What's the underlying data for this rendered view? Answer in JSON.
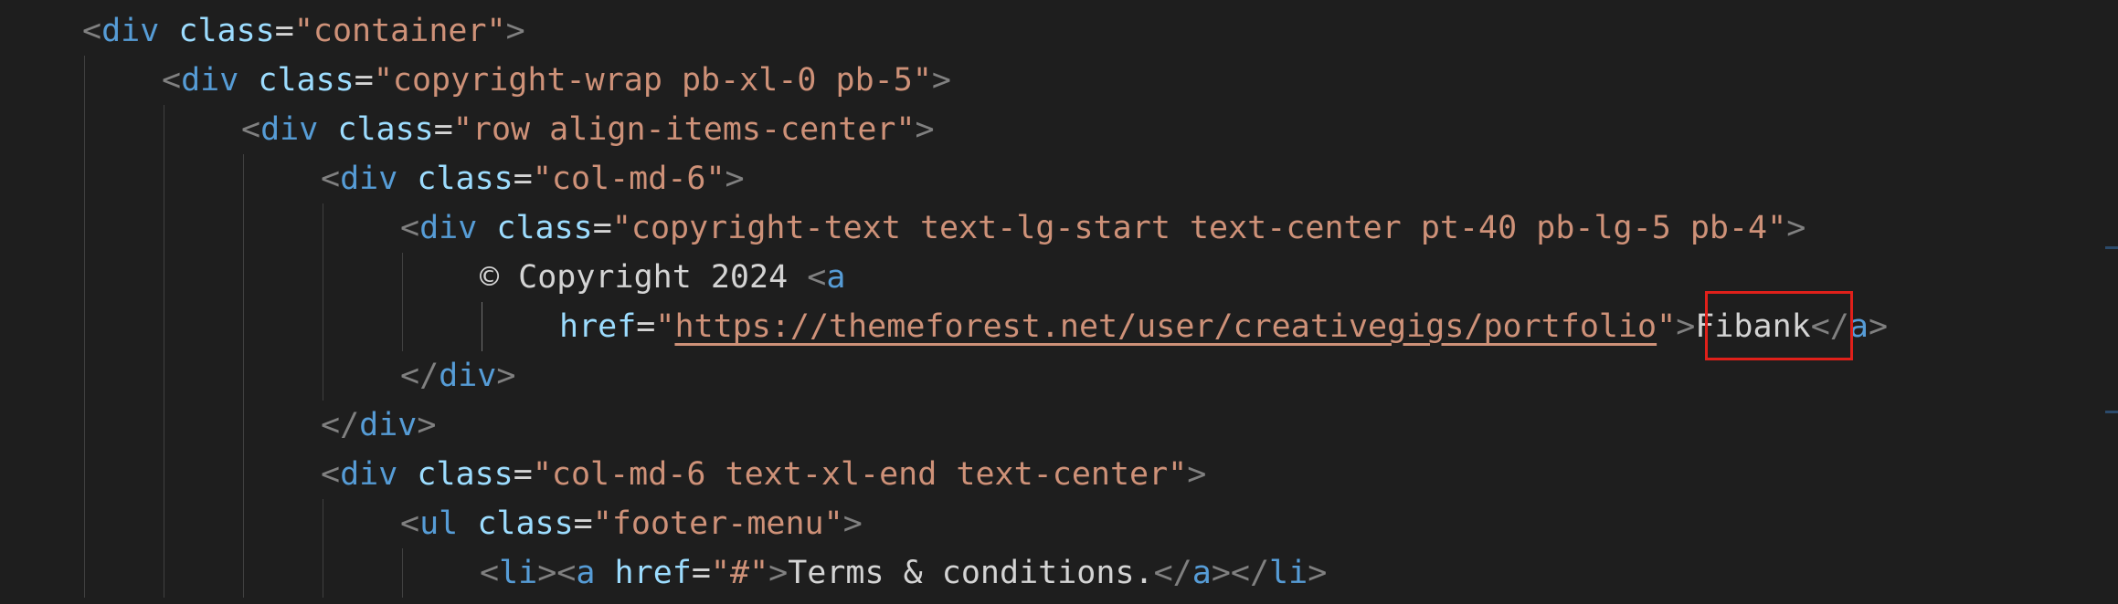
{
  "editor": {
    "lines": [
      {
        "indent": 1,
        "tokens": [
          {
            "t": "punc",
            "v": "<"
          },
          {
            "t": "tag",
            "v": "div"
          },
          {
            "t": "text",
            "v": " "
          },
          {
            "t": "attr",
            "v": "class"
          },
          {
            "t": "text",
            "v": "="
          },
          {
            "t": "str",
            "v": "\"container\""
          },
          {
            "t": "punc",
            "v": ">"
          }
        ]
      },
      {
        "indent": 2,
        "tokens": [
          {
            "t": "punc",
            "v": "<"
          },
          {
            "t": "tag",
            "v": "div"
          },
          {
            "t": "text",
            "v": " "
          },
          {
            "t": "attr",
            "v": "class"
          },
          {
            "t": "text",
            "v": "="
          },
          {
            "t": "str",
            "v": "\"copyright-wrap pb-xl-0 pb-5\""
          },
          {
            "t": "punc",
            "v": ">"
          }
        ]
      },
      {
        "indent": 3,
        "tokens": [
          {
            "t": "punc",
            "v": "<"
          },
          {
            "t": "tag",
            "v": "div"
          },
          {
            "t": "text",
            "v": " "
          },
          {
            "t": "attr",
            "v": "class"
          },
          {
            "t": "text",
            "v": "="
          },
          {
            "t": "str",
            "v": "\"row align-items-center\""
          },
          {
            "t": "punc",
            "v": ">"
          }
        ]
      },
      {
        "indent": 4,
        "tokens": [
          {
            "t": "punc",
            "v": "<"
          },
          {
            "t": "tag",
            "v": "div"
          },
          {
            "t": "text",
            "v": " "
          },
          {
            "t": "attr",
            "v": "class"
          },
          {
            "t": "text",
            "v": "="
          },
          {
            "t": "str",
            "v": "\"col-md-6\""
          },
          {
            "t": "punc",
            "v": ">"
          }
        ]
      },
      {
        "indent": 5,
        "tokens": [
          {
            "t": "punc",
            "v": "<"
          },
          {
            "t": "tag",
            "v": "div"
          },
          {
            "t": "text",
            "v": " "
          },
          {
            "t": "attr",
            "v": "class"
          },
          {
            "t": "text",
            "v": "="
          },
          {
            "t": "str",
            "v": "\"copyright-text text-lg-start text-center pt-40 pb-lg-5 pb-4\""
          },
          {
            "t": "punc",
            "v": ">"
          }
        ]
      },
      {
        "indent": 6,
        "tokens": [
          {
            "t": "text",
            "v": "© Copyright 2024 "
          },
          {
            "t": "punc",
            "v": "<"
          },
          {
            "t": "tag",
            "v": "a"
          }
        ]
      },
      {
        "indent": 7,
        "tokens": [
          {
            "t": "attr",
            "v": "href"
          },
          {
            "t": "text",
            "v": "="
          },
          {
            "t": "str",
            "v": "\""
          },
          {
            "t": "str link",
            "v": "https://themeforest.net/user/creativegigs/portfolio"
          },
          {
            "t": "str",
            "v": "\""
          },
          {
            "t": "punc",
            "v": ">"
          },
          {
            "t": "text",
            "v": "Fibank"
          },
          {
            "t": "punc",
            "v": "</"
          },
          {
            "t": "tag",
            "v": "a"
          },
          {
            "t": "punc",
            "v": ">"
          }
        ]
      },
      {
        "indent": 5,
        "tokens": [
          {
            "t": "punc",
            "v": "</"
          },
          {
            "t": "tag",
            "v": "div"
          },
          {
            "t": "punc",
            "v": ">"
          }
        ]
      },
      {
        "indent": 4,
        "tokens": [
          {
            "t": "punc",
            "v": "</"
          },
          {
            "t": "tag",
            "v": "div"
          },
          {
            "t": "punc",
            "v": ">"
          }
        ]
      },
      {
        "indent": 4,
        "tokens": [
          {
            "t": "punc",
            "v": "<"
          },
          {
            "t": "tag",
            "v": "div"
          },
          {
            "t": "text",
            "v": " "
          },
          {
            "t": "attr",
            "v": "class"
          },
          {
            "t": "text",
            "v": "="
          },
          {
            "t": "str",
            "v": "\"col-md-6 text-xl-end text-center\""
          },
          {
            "t": "punc",
            "v": ">"
          }
        ]
      },
      {
        "indent": 5,
        "tokens": [
          {
            "t": "punc",
            "v": "<"
          },
          {
            "t": "tag",
            "v": "ul"
          },
          {
            "t": "text",
            "v": " "
          },
          {
            "t": "attr",
            "v": "class"
          },
          {
            "t": "text",
            "v": "="
          },
          {
            "t": "str",
            "v": "\"footer-menu\""
          },
          {
            "t": "punc",
            "v": ">"
          }
        ]
      },
      {
        "indent": 6,
        "tokens": [
          {
            "t": "punc",
            "v": "<"
          },
          {
            "t": "tag",
            "v": "li"
          },
          {
            "t": "punc",
            "v": "><"
          },
          {
            "t": "tag",
            "v": "a"
          },
          {
            "t": "text",
            "v": " "
          },
          {
            "t": "attr",
            "v": "href"
          },
          {
            "t": "text",
            "v": "="
          },
          {
            "t": "str",
            "v": "\"#\""
          },
          {
            "t": "punc",
            "v": ">"
          },
          {
            "t": "text",
            "v": "Terms & conditions."
          },
          {
            "t": "punc",
            "v": "</"
          },
          {
            "t": "tag",
            "v": "a"
          },
          {
            "t": "punc",
            "v": "></"
          },
          {
            "t": "tag",
            "v": "li"
          },
          {
            "t": "punc",
            "v": ">"
          }
        ]
      }
    ],
    "highlighted_text": "Fibank",
    "highlight_color": "#e0201a"
  }
}
